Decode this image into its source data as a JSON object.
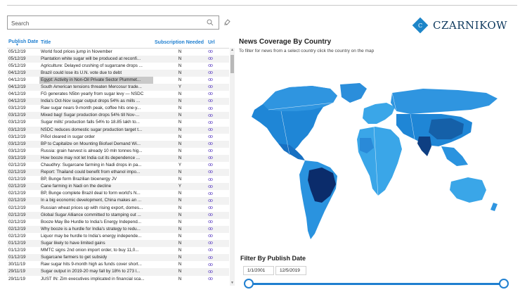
{
  "search": {
    "placeholder": "Search",
    "value": ""
  },
  "brand": {
    "name": "CZARNIKOW"
  },
  "table": {
    "columns": [
      "Publish Date",
      "Title",
      "Subscription Needed",
      "Url"
    ],
    "rows": [
      [
        "05/12/19",
        "World food prices jump in November",
        "N"
      ],
      [
        "05/12/19",
        "Plantation white sugar will be produced at reconfi...",
        "N"
      ],
      [
        "05/12/19",
        "Agriculture: Delayed crushing of sugarcane drops ...",
        "N"
      ],
      [
        "04/12/19",
        "Brazil could lose its U.N. vote due to debt",
        "N"
      ],
      [
        "04/12/19",
        "Egypt: Activity in Non-Oil Private Sector Plummet...",
        "N"
      ],
      [
        "04/12/19",
        "South American tensions threaten Mercosur trade...",
        "Y"
      ],
      [
        "04/12/19",
        "FG generates N5bn yearly from sugar levy — NSDC",
        "N"
      ],
      [
        "04/12/19",
        "India's Oct-Nov sugar output drops 54% as mills ...",
        "N"
      ],
      [
        "03/12/19",
        "Raw sugar nears 9-month peak, coffee hits one-y...",
        "N"
      ],
      [
        "03/12/19",
        "Mixed bag! Sugar production drops 54% till Nov-...",
        "N"
      ],
      [
        "03/12/19",
        "Sugar mills' production falls 54% to 18.85 lakh to...",
        "N"
      ],
      [
        "03/12/19",
        "NSDC reduces domestic sugar production target t...",
        "N"
      ],
      [
        "03/12/19",
        "Piñol cleared in sugar order",
        "N"
      ],
      [
        "03/12/19",
        "BP to Capitalize on Mounting Biofuel Demand Wi...",
        "N"
      ],
      [
        "03/12/19",
        "Russia: grain harvest is already 10 mln tonnes hig...",
        "N"
      ],
      [
        "03/12/19",
        "How booze may not let India cut its dependence ...",
        "N"
      ],
      [
        "02/12/19",
        "Chaudhry: Sugarcane farming in Nadi drops in pa...",
        "Y"
      ],
      [
        "02/12/19",
        "Report: Thailand could benefit from ethanol impo...",
        "N"
      ],
      [
        "02/12/19",
        "BP, Bunge form Brazilian bioenergy JV",
        "N"
      ],
      [
        "02/12/19",
        "Cane farming in Nadi on the decline",
        "Y"
      ],
      [
        "02/12/19",
        "BP, Bunge complete Brazil deal to form world's N...",
        "N"
      ],
      [
        "02/12/19",
        "In a big economic development, China makes an ...",
        "N"
      ],
      [
        "02/12/19",
        "Russian wheat prices up with rising export, domes...",
        "N"
      ],
      [
        "02/12/19",
        "Global Sugar Alliance committed to stamping out ...",
        "N"
      ],
      [
        "02/12/19",
        "Booze May Be Hurdle to India's Energy Independ...",
        "N"
      ],
      [
        "02/12/19",
        "Why booze is a hurdle for India's strategy to redu...",
        "N"
      ],
      [
        "02/12/19",
        "Liquor may be hurdle to India's energy independe...",
        "N"
      ],
      [
        "01/12/19",
        "Sugar likely to have limited gains",
        "N"
      ],
      [
        "01/12/19",
        "MMTC signs 2nd onion import order, to buy 11,0...",
        "N"
      ],
      [
        "01/12/19",
        "Sugarcane farmers to get subsidy",
        "N"
      ],
      [
        "30/11/19",
        "Raw sugar hits 9-month high as funds cover short...",
        "N"
      ],
      [
        "29/11/19",
        "Sugar output in 2019-20 may fall by 18% to 273 l...",
        "N"
      ],
      [
        "29/11/19",
        "JUST IN: Zim executives implicated in financial sca...",
        "N"
      ]
    ]
  },
  "map": {
    "title": "News Coverage By Country",
    "subtitle": "To filter for news from a select country click the country on the map"
  },
  "filter": {
    "title": "Filter By Publish Date",
    "start": "1/1/2001",
    "end": "12/5/2019"
  },
  "colors": {
    "accent": "#1f7fd0",
    "map_light": "#3aa6e8",
    "map_mid": "#1560a8",
    "map_dark": "#0b2c6b"
  },
  "icons": {
    "search": "search-icon",
    "eraser": "eraser-icon",
    "url": "link-icon",
    "logo": "czarnikow-logo-icon"
  }
}
